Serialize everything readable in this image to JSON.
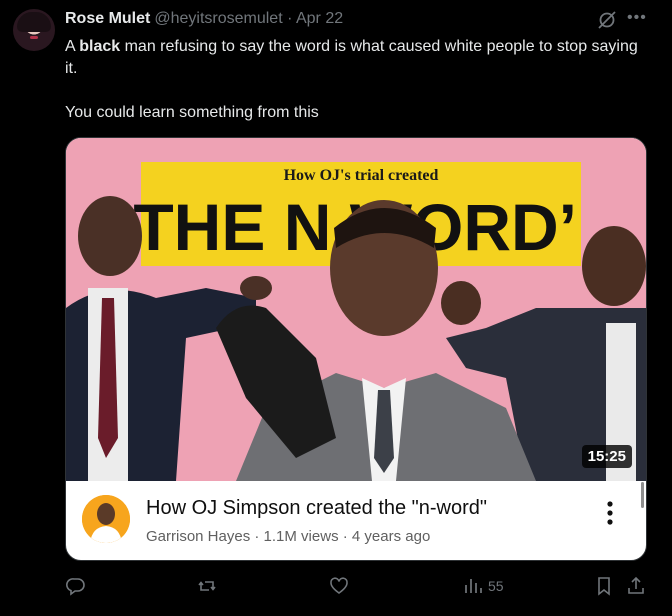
{
  "author": {
    "name": "Rose Mulet",
    "handle": "@heyitsrosemulet",
    "separator": "·",
    "date": "Apr 22"
  },
  "tweet": {
    "line1_prefix": "A ",
    "line1_bold": "black",
    "line1_rest": " man refusing to say the word is what caused white people to stop saying it.",
    "line2": "You could learn something from this"
  },
  "card": {
    "thumbnail_small_title": "How OJ's trial created",
    "thumbnail_big_title": "‘THE N WORD’",
    "duration": "15:25",
    "video_title": "How OJ Simpson created the \"n-word\"",
    "channel": "Garrison Hayes",
    "views": "1.1M views",
    "age": "4 years ago",
    "meta_separator": " · "
  },
  "actions": {
    "views_count": "55"
  },
  "colors": {
    "background": "#000000",
    "text": "#e7e9ea",
    "muted": "#71767b",
    "thumbnail_pink": "#f2a7b8",
    "thumbnail_yellow": "#f4d21f"
  },
  "icons": [
    "grok-icon",
    "more-icon",
    "kebab-icon",
    "reply-icon",
    "retweet-icon",
    "like-icon",
    "views-icon",
    "bookmark-icon",
    "share-icon"
  ]
}
